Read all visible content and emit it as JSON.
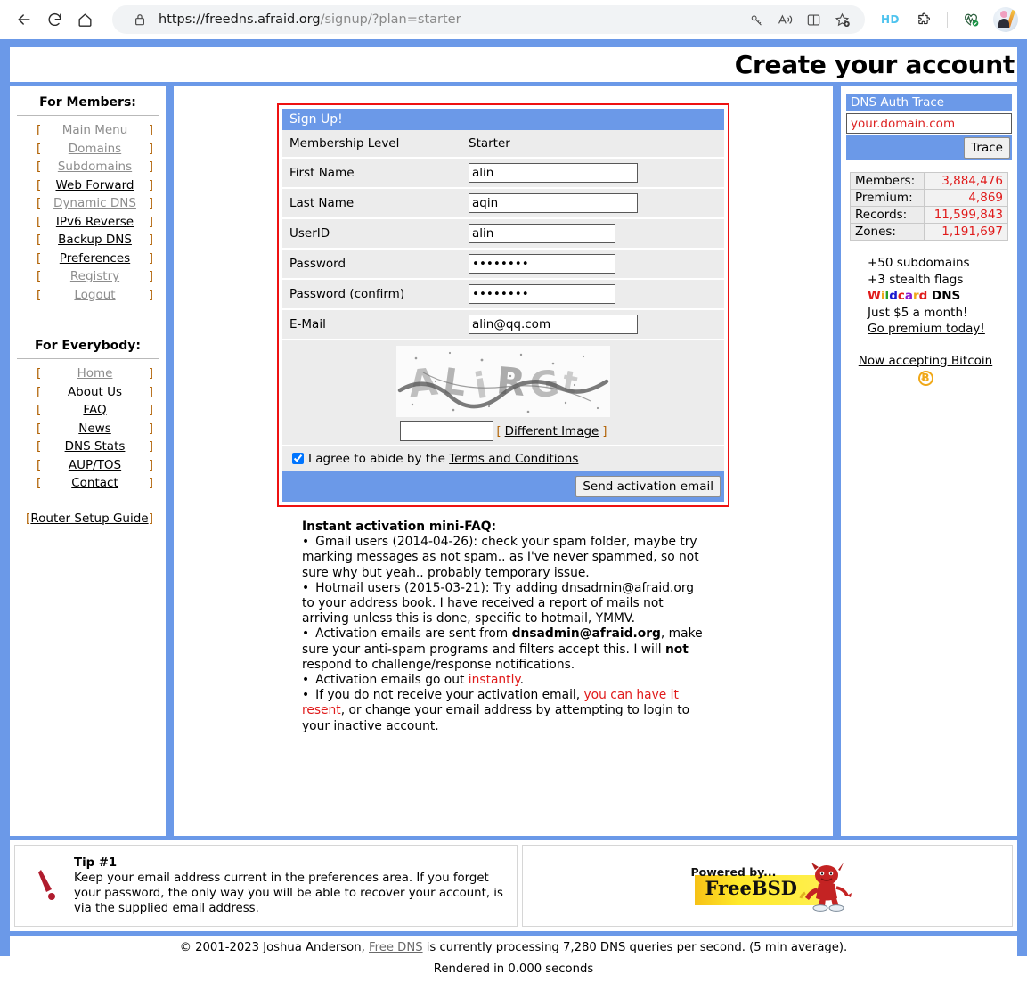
{
  "browser": {
    "url_main": "https://freedns.afraid.org",
    "url_path": "/signup/?plan=starter",
    "back_icon": "back-arrow-icon",
    "reload_icon": "reload-icon",
    "home_icon": "home-icon",
    "lock_icon": "lock-icon",
    "key_icon": "key-icon",
    "read_aloud_icon": "read-aloud-icon",
    "split_screen_icon": "split-screen-icon",
    "favorite_icon": "add-favorite-icon",
    "hd_badge": "HD",
    "extension_icon": "extension-puzzle-icon",
    "browser_essentials_icon": "browser-essentials-icon",
    "profile_icon": "profile-avatar-icon"
  },
  "header": {
    "title": "Create your account"
  },
  "sidebar": {
    "members_title": "For Members:",
    "members_items": [
      {
        "label": "Main Menu",
        "muted": true
      },
      {
        "label": "Domains",
        "muted": true
      },
      {
        "label": "Subdomains",
        "muted": true
      },
      {
        "label": "Web Forward",
        "muted": false
      },
      {
        "label": "Dynamic DNS",
        "muted": true
      },
      {
        "label": "IPv6 Reverse",
        "muted": false
      },
      {
        "label": "Backup DNS",
        "muted": false
      },
      {
        "label": "Preferences",
        "muted": false
      },
      {
        "label": "Registry",
        "muted": true
      },
      {
        "label": "Logout",
        "muted": true
      }
    ],
    "everybody_title": "For Everybody:",
    "everybody_items": [
      {
        "label": "Home",
        "muted": true
      },
      {
        "label": "About Us",
        "muted": false
      },
      {
        "label": "FAQ",
        "muted": false
      },
      {
        "label": "News",
        "muted": false
      },
      {
        "label": "DNS Stats",
        "muted": false
      },
      {
        "label": "AUP/TOS",
        "muted": false
      },
      {
        "label": "Contact",
        "muted": false
      }
    ],
    "router_guide": "Router Setup Guide",
    "bracket_open": "[",
    "bracket_close": "]"
  },
  "signup": {
    "heading": "Sign Up!",
    "rows": [
      {
        "label": "Membership Level",
        "value": "Starter",
        "type": "text"
      },
      {
        "label": "First Name",
        "value": "alin",
        "type": "input",
        "width": "w190"
      },
      {
        "label": "Last Name",
        "value": "aqin",
        "type": "input",
        "width": "w190"
      },
      {
        "label": "UserID",
        "value": "alin",
        "type": "input",
        "width": "w165"
      },
      {
        "label": "Password",
        "value": "••••••••",
        "type": "password",
        "width": "w165"
      },
      {
        "label": "Password (confirm)",
        "value": "••••••••",
        "type": "password",
        "width": "w165"
      },
      {
        "label": "E-Mail",
        "value": "alin@qq.com",
        "type": "input",
        "width": "w190"
      }
    ],
    "captcha_value": "",
    "different_image": "Different Image",
    "bracket_open": "[",
    "bracket_close": "]",
    "terms_prefix": "I agree to abide by the",
    "terms_link": "Terms and Conditions",
    "terms_checked": true,
    "submit_label": "Send activation email"
  },
  "faq": {
    "title": "Instant activation mini-FAQ:",
    "bullet": "•",
    "items": [
      "Gmail users (2014-04-26): check your spam folder, maybe try marking messages as not spam.. as I've never spammed, so not sure why but yeah.. probably temporary issue.",
      "Hotmail users (2015-03-21): Try adding dnsadmin@afraid.org to your address book. I have received a report of mails not arriving unless this is done, specific to hotmail, YMMV."
    ],
    "item3_a": "Activation emails are sent from ",
    "item3_b": "dnsadmin@afraid.org",
    "item3_c": ", make sure your anti-spam programs and filters accept this. I will ",
    "item3_d": "not",
    "item3_e": " respond to challenge/response notifications.",
    "item4_a": "Activation emails go out ",
    "item4_b": "instantly",
    "item4_c": ".",
    "item5_a": "If you do not receive your activation email, ",
    "item5_b": "you can have it resent",
    "item5_c": ", or change your email address by attempting to login to your inactive account."
  },
  "trace": {
    "heading": "DNS Auth Trace",
    "domain_value": "your.domain.com",
    "button_label": "Trace"
  },
  "stats": {
    "rows": [
      {
        "key": "Members:",
        "value": "3,884,476"
      },
      {
        "key": "Premium:",
        "value": "4,869"
      },
      {
        "key": "Records:",
        "value": "11,599,843"
      },
      {
        "key": "Zones:",
        "value": "1,191,697"
      }
    ]
  },
  "promo": {
    "line1": "+50 subdomains",
    "line2": "+3 stealth flags",
    "wildcard_letters": [
      {
        "ch": "W",
        "color": "#e01b1b"
      },
      {
        "ch": "i",
        "color": "#f0a818"
      },
      {
        "ch": "l",
        "color": "#2aa02a"
      },
      {
        "ch": "d",
        "color": "#1a1ad0"
      },
      {
        "ch": "c",
        "color": "#e01b1b"
      },
      {
        "ch": "a",
        "color": "#8b1ad0"
      },
      {
        "ch": "r",
        "color": "#f0a818"
      },
      {
        "ch": "d",
        "color": "#e01b1b"
      }
    ],
    "wildcard_suffix": " DNS",
    "line4": "Just $5 a month!",
    "line5": "Go premium today!",
    "bitcoin_text": "Now accepting Bitcoin",
    "bitcoin_symbol": "Ƀ"
  },
  "tip": {
    "title": "Tip #1",
    "body": "Keep your email address current in the preferences area. If you forget your password, the only way you will be able to recover your account, is via the supplied email address.",
    "icon": "exclamation-mark-icon"
  },
  "freebsd": {
    "powered": "Powered by...",
    "name": "FreeBSD",
    "daemon_icon": "beastie-daemon-icon"
  },
  "footer": {
    "copyright_a": "© 2001-2023 Joshua Anderson, ",
    "link": "Free DNS",
    "copyright_b": " is currently processing 7,280 DNS queries per second. (5 min average).",
    "rendered": "Rendered in 0.000 seconds"
  },
  "colors": {
    "frame_blue": "#6b99e8",
    "highlight_red": "#ee1111",
    "row_gray": "#ececec",
    "stat_red": "#e01b1b"
  }
}
